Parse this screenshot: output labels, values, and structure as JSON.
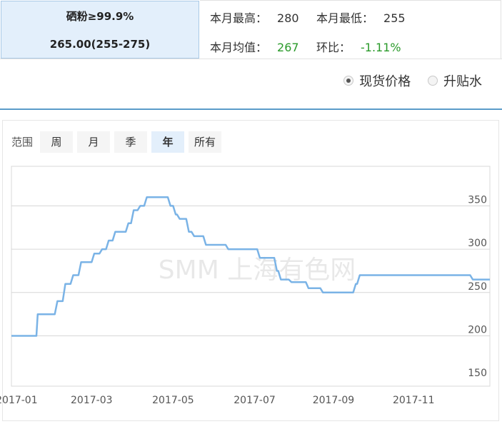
{
  "product": {
    "name": "硒粉≥99.9%",
    "price": "265.00(255-275)"
  },
  "stats": {
    "high_label": "本月最高：",
    "high_value": "280",
    "low_label": "本月最低：",
    "low_value": "255",
    "avg_label": "本月均值：",
    "avg_value": "267",
    "mom_label": "环比：",
    "mom_value": "-1.11%"
  },
  "price_toggle": {
    "options": [
      "现货价格",
      "升贴水"
    ],
    "selected": "现货价格"
  },
  "range": {
    "label": "范围",
    "buttons": [
      "周",
      "月",
      "季",
      "年",
      "所有"
    ],
    "active": "年"
  },
  "watermark": "SMM 上海有色网",
  "colors": {
    "line": "#7ab3e6",
    "active_bg": "#e3effb",
    "down": "#2a9a2a"
  },
  "chart_data": {
    "type": "line",
    "ylim": [
      150,
      375
    ],
    "yticks": [
      150,
      200,
      250,
      300,
      350
    ],
    "xticks": [
      "2017-01",
      "2017-03",
      "2017-05",
      "2017-07",
      "2017-09",
      "2017-11"
    ],
    "xtick_dates": [
      "2017-01-03",
      "2017-03-01",
      "2017-05-02",
      "2017-07-03",
      "2017-09-01",
      "2017-11-01"
    ],
    "x_range": [
      "2016-12-30",
      "2017-12-29"
    ],
    "series": [
      {
        "points": [
          [
            "2016-12-30",
            200
          ],
          [
            "2017-01-18",
            200
          ],
          [
            "2017-01-19",
            225
          ],
          [
            "2017-02-01",
            225
          ],
          [
            "2017-02-03",
            240
          ],
          [
            "2017-02-07",
            240
          ],
          [
            "2017-02-09",
            260
          ],
          [
            "2017-02-13",
            260
          ],
          [
            "2017-02-15",
            270
          ],
          [
            "2017-02-19",
            270
          ],
          [
            "2017-02-21",
            285
          ],
          [
            "2017-03-01",
            285
          ],
          [
            "2017-03-03",
            295
          ],
          [
            "2017-03-07",
            295
          ],
          [
            "2017-03-09",
            300
          ],
          [
            "2017-03-12",
            300
          ],
          [
            "2017-03-14",
            310
          ],
          [
            "2017-03-17",
            310
          ],
          [
            "2017-03-19",
            320
          ],
          [
            "2017-03-27",
            320
          ],
          [
            "2017-03-29",
            330
          ],
          [
            "2017-03-31",
            330
          ],
          [
            "2017-04-02",
            345
          ],
          [
            "2017-04-05",
            345
          ],
          [
            "2017-04-07",
            350
          ],
          [
            "2017-04-10",
            350
          ],
          [
            "2017-04-12",
            360
          ],
          [
            "2017-04-28",
            360
          ],
          [
            "2017-04-30",
            350
          ],
          [
            "2017-05-02",
            350
          ],
          [
            "2017-05-04",
            340
          ],
          [
            "2017-05-05",
            340
          ],
          [
            "2017-05-07",
            335
          ],
          [
            "2017-05-12",
            335
          ],
          [
            "2017-05-14",
            320
          ],
          [
            "2017-05-16",
            320
          ],
          [
            "2017-05-18",
            315
          ],
          [
            "2017-05-25",
            315
          ],
          [
            "2017-05-27",
            305
          ],
          [
            "2017-06-11",
            305
          ],
          [
            "2017-06-13",
            300
          ],
          [
            "2017-07-05",
            300
          ],
          [
            "2017-07-07",
            290
          ],
          [
            "2017-07-18",
            290
          ],
          [
            "2017-07-20",
            275
          ],
          [
            "2017-07-21",
            275
          ],
          [
            "2017-07-23",
            265
          ],
          [
            "2017-07-29",
            265
          ],
          [
            "2017-07-31",
            262
          ],
          [
            "2017-08-11",
            262
          ],
          [
            "2017-08-13",
            255
          ],
          [
            "2017-08-22",
            255
          ],
          [
            "2017-08-24",
            250
          ],
          [
            "2017-09-16",
            250
          ],
          [
            "2017-09-18",
            260
          ],
          [
            "2017-09-19",
            260
          ],
          [
            "2017-09-21",
            270
          ],
          [
            "2017-12-14",
            270
          ],
          [
            "2017-12-16",
            265
          ],
          [
            "2017-12-29",
            265
          ]
        ]
      }
    ]
  }
}
